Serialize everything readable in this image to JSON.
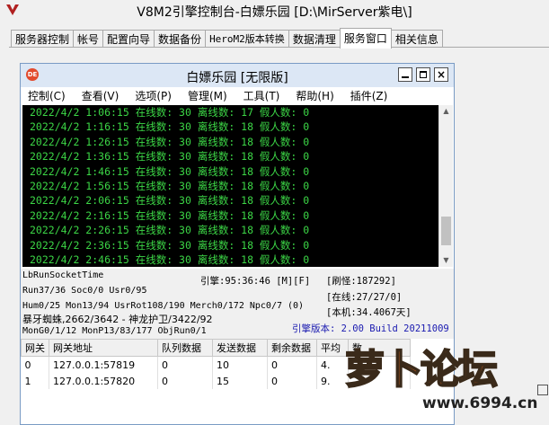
{
  "window": {
    "title": "V8M2引擎控制台-白嫖乐园 [D:\\MirServer紫电\\]"
  },
  "tabs": [
    {
      "label": "服务器控制"
    },
    {
      "label": "帐号"
    },
    {
      "label": "配置向导"
    },
    {
      "label": "数据备份"
    },
    {
      "label": "HeroM2版本转换"
    },
    {
      "label": "数据清理"
    },
    {
      "label": "服务窗口",
      "active": true
    },
    {
      "label": "相关信息"
    }
  ],
  "inner": {
    "logo_text": "DE",
    "title": "白嫖乐园 [无限版]",
    "close_glyph": "×",
    "menu": [
      "控制(C)",
      "查看(V)",
      "选项(P)",
      "管理(M)",
      "工具(T)",
      "帮助(H)",
      "插件(Z)"
    ]
  },
  "console_lines": [
    "2022/4/2 1:06:15 在线数: 30 离线数: 17 假人数: 0",
    "2022/4/2 1:16:15 在线数: 30 离线数: 18 假人数: 0",
    "2022/4/2 1:26:15 在线数: 30 离线数: 18 假人数: 0",
    "2022/4/2 1:36:15 在线数: 30 离线数: 18 假人数: 0",
    "2022/4/2 1:46:15 在线数: 30 离线数: 18 假人数: 0",
    "2022/4/2 1:56:15 在线数: 30 离线数: 18 假人数: 0",
    "2022/4/2 2:06:15 在线数: 30 离线数: 18 假人数: 0",
    "2022/4/2 2:16:15 在线数: 30 离线数: 18 假人数: 0",
    "2022/4/2 2:26:15 在线数: 30 离线数: 18 假人数: 0",
    "2022/4/2 2:36:15 在线数: 30 离线数: 18 假人数: 0",
    "2022/4/2 2:46:15 在线数: 30 离线数: 18 假人数: 0"
  ],
  "status": {
    "socket": "LbRunSocketTime",
    "engine_time": "引擎:95:36:46 [M][F]",
    "refresh": "[刷怪:187292]",
    "run": "Run37/36 Soc0/0 Usr0/95",
    "online": "[在线:27/27/0]",
    "hum": "Hum0/25 Mon13/94 UsrRot108/190 Merch0/172 Npc0/7 (0)",
    "local": "[本机:34.4067天]",
    "boss": "暴牙蜘蛛,2662/3642 - 神龙护卫/3422/92",
    "mon": "MonG0/1/12 MonP13/83/177 ObjRun0/1",
    "version": "引擎版本: 2.00 Build 20211009"
  },
  "table": {
    "headers": [
      "网关",
      "网关地址",
      "队列数据",
      "发送数据",
      "剩余数据",
      "平均",
      "数"
    ],
    "rows": [
      [
        "0",
        "127.0.0.1:57819",
        "0",
        "10",
        "0",
        "4."
      ],
      [
        "1",
        "127.0.0.1:57820",
        "0",
        "15",
        "0",
        "9."
      ]
    ]
  },
  "watermark": {
    "logo": "萝卜论坛",
    "url": "www.6994.cn"
  },
  "colors": {
    "console_text": "#3cd646",
    "console_bg": "#000000",
    "version_text": "#1a1ab0",
    "watermark": "#f06a1c"
  }
}
